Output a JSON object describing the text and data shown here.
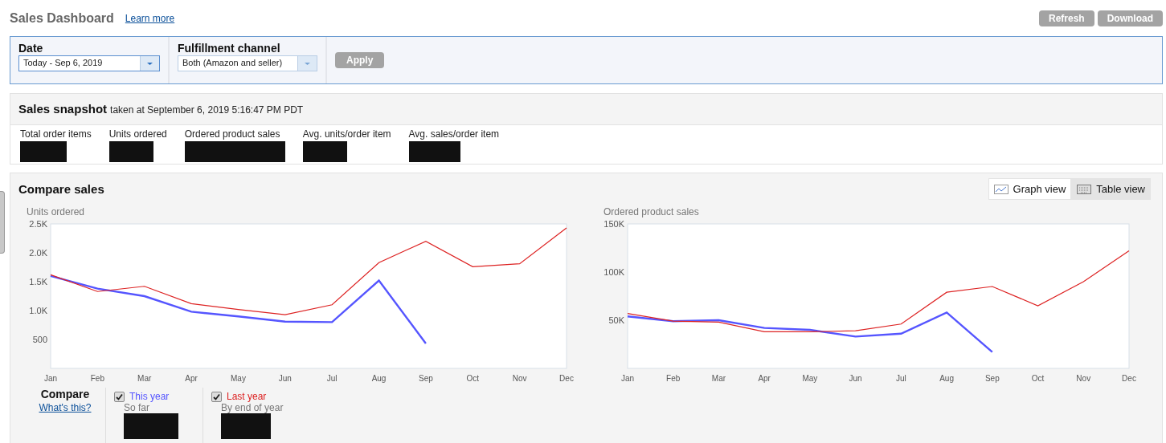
{
  "header": {
    "title": "Sales Dashboard",
    "link": "Learn more",
    "buttons": [
      "Refresh",
      "Download"
    ]
  },
  "filters": {
    "fields": [
      {
        "label": "Date",
        "value": "Today - Sep 6, 2019",
        "focused": true
      },
      {
        "label": "Fulfillment channel",
        "value": "Both (Amazon and seller)",
        "focused": false
      }
    ],
    "apply": "Apply"
  },
  "snapshot": {
    "title": "Sales snapshot",
    "subtitle": "taken at September 6, 2019 5:16:47 PM PDT",
    "metrics": [
      "Total order items",
      "Units ordered",
      "Ordered product sales",
      "Avg. units/order item",
      "Avg. sales/order item"
    ]
  },
  "compare": {
    "title": "Compare sales",
    "views": [
      {
        "label": "Graph view",
        "kind": "graph",
        "selected": true
      },
      {
        "label": "Table view",
        "kind": "table",
        "selected": false
      }
    ],
    "charts": [
      {
        "chart_data": {
          "type": "line",
          "title": "Units ordered",
          "categories": [
            "Jan",
            "Feb",
            "Mar",
            "Apr",
            "May",
            "Jun",
            "Jul",
            "Aug",
            "Sep",
            "Oct",
            "Nov",
            "Dec"
          ],
          "ylim": [
            0,
            2500
          ],
          "yticks": [
            {
              "value": 2500,
              "label": "2.5K"
            },
            {
              "value": 2000,
              "label": "2.0K"
            },
            {
              "value": 1500,
              "label": "1.5K"
            },
            {
              "value": 1000,
              "label": "1.0K"
            },
            {
              "value": 500,
              "label": "500"
            }
          ],
          "series": [
            {
              "color": "#5555ff",
              "values": [
                1600,
                1380,
                1250,
                980,
                900,
                810,
                800,
                1520,
                430,
                null,
                null,
                null
              ]
            },
            {
              "color": "#dd2222",
              "values": [
                1620,
                1330,
                1420,
                1120,
                1020,
                930,
                1100,
                1830,
                2200,
                1760,
                1810,
                2430
              ]
            }
          ]
        }
      },
      {
        "chart_data": {
          "type": "line",
          "title": "Ordered product sales",
          "categories": [
            "Jan",
            "Feb",
            "Mar",
            "Apr",
            "May",
            "Jun",
            "Jul",
            "Aug",
            "Sep",
            "Oct",
            "Nov",
            "Dec"
          ],
          "ylim": [
            0,
            150000
          ],
          "yticks": [
            {
              "value": 150000,
              "label": "150K"
            },
            {
              "value": 100000,
              "label": "100K"
            },
            {
              "value": 50000,
              "label": "50K"
            }
          ],
          "series": [
            {
              "color": "#5555ff",
              "values": [
                54000,
                49000,
                50000,
                42000,
                40000,
                33000,
                36000,
                58000,
                17000,
                null,
                null,
                null
              ]
            },
            {
              "color": "#dd2222",
              "values": [
                57000,
                49000,
                48000,
                38000,
                38000,
                39000,
                46000,
                79000,
                85000,
                65000,
                90000,
                122000
              ]
            }
          ]
        }
      }
    ],
    "legend": {
      "title": "Compare",
      "link": "What's this?",
      "items": [
        {
          "name": "This year",
          "color": "#5555ff",
          "checked": true,
          "note": "So far"
        },
        {
          "name": "Last year",
          "color": "#dd2222",
          "checked": true,
          "note": "By end of year"
        }
      ]
    }
  }
}
